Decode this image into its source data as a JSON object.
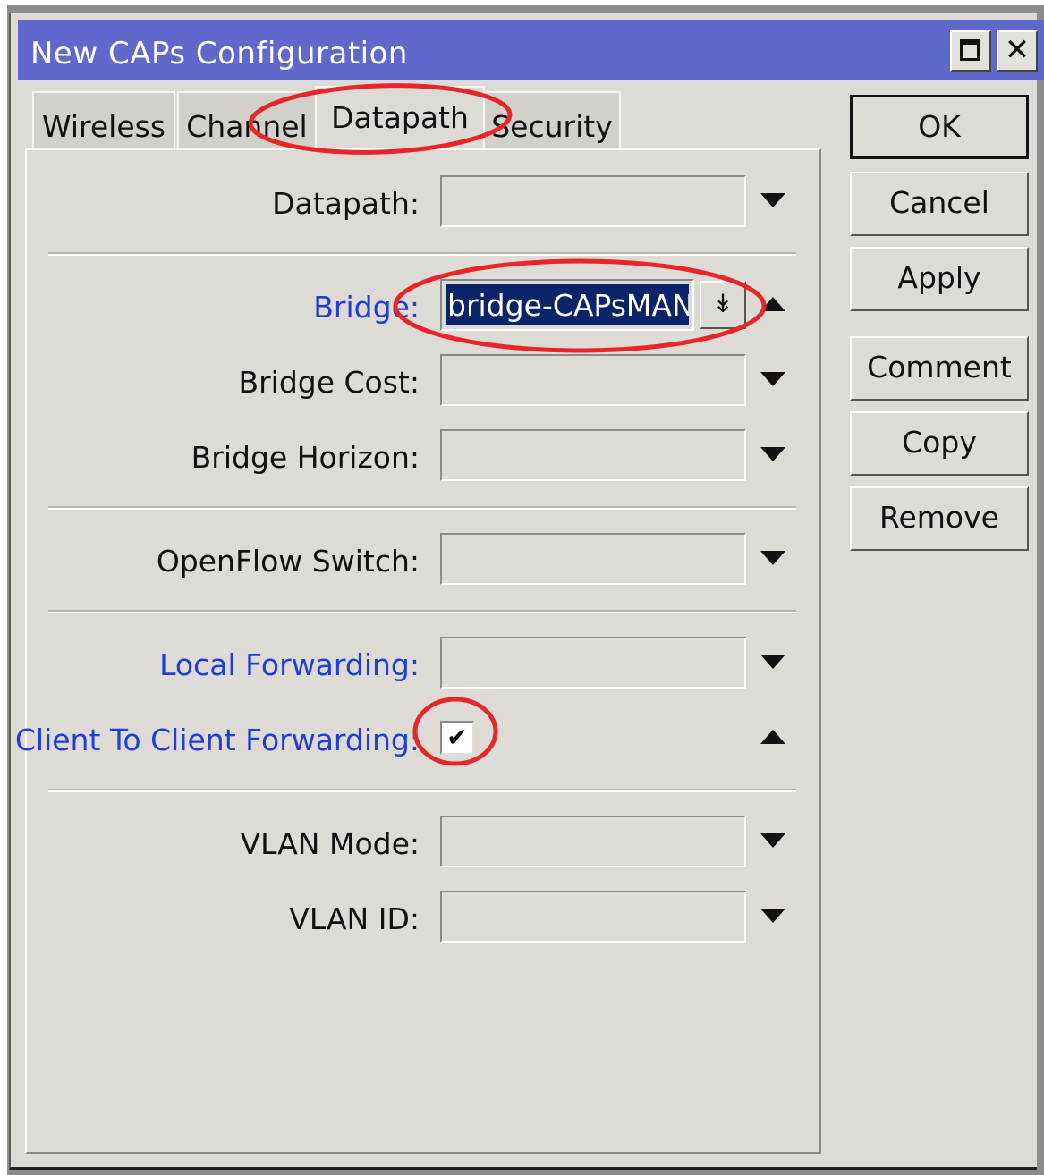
{
  "window": {
    "title": "New CAPs Configuration"
  },
  "titlebar_buttons": {
    "maximize": "maximize-icon",
    "close": "close-icon",
    "close_glyph": "✕"
  },
  "tabs": [
    {
      "label": "Wireless",
      "active": false
    },
    {
      "label": "Channel",
      "active": false
    },
    {
      "label": "Datapath",
      "active": true
    },
    {
      "label": "Security",
      "active": false
    }
  ],
  "fields": {
    "datapath": {
      "label": "Datapath:",
      "value": ""
    },
    "bridge": {
      "label": "Bridge:",
      "value": "bridge-CAPsMAN"
    },
    "bridge_cost": {
      "label": "Bridge Cost:",
      "value": ""
    },
    "bridge_horizon": {
      "label": "Bridge Horizon:",
      "value": ""
    },
    "openflow_switch": {
      "label": "OpenFlow Switch:",
      "value": ""
    },
    "local_forwarding": {
      "label": "Local Forwarding:",
      "value": ""
    },
    "client_to_client": {
      "label": "Client To Client Forwarding:",
      "checked": true
    },
    "vlan_mode": {
      "label": "VLAN Mode:",
      "value": ""
    },
    "vlan_id": {
      "label": "VLAN ID:",
      "value": ""
    }
  },
  "buttons": {
    "ok": "OK",
    "cancel": "Cancel",
    "apply": "Apply",
    "comment": "Comment",
    "copy": "Copy",
    "remove": "Remove"
  },
  "glyphs": {
    "dropdown_list": "↡",
    "checkmark": "✔"
  },
  "colors": {
    "titlebar": "#6068cc",
    "link_label": "#1f3ed8",
    "selection": "#0a246a",
    "annotation": "#e8262a"
  }
}
